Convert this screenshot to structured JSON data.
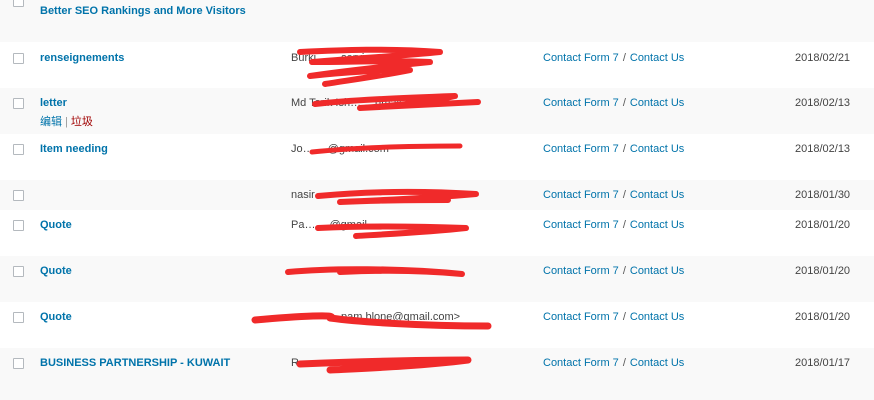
{
  "rows": [
    {
      "subject": "Better SEO Rankings and More Visitors",
      "from": "",
      "form_name": "",
      "form_page": "",
      "date": ""
    },
    {
      "subject": "renseignements",
      "from": "Burki… …services",
      "form_name": "Contact Form 7",
      "form_page": "Contact Us",
      "date": "2018/02/21"
    },
    {
      "subject": "letter",
      "from": "Md Tarik Ish… …gmail.com>",
      "form_name": "Contact Form 7",
      "form_page": "Contact Us",
      "date": "2018/02/13",
      "actions": {
        "edit": "编辑",
        "separator": "|",
        "trash": "垃圾"
      }
    },
    {
      "subject": "Item needing",
      "from": "Jo… …@gmail.com",
      "form_name": "Contact Form 7",
      "form_page": "Contact Us",
      "date": "2018/02/13"
    },
    {
      "subject": "",
      "from": "nasir",
      "form_name": "Contact Form 7",
      "form_page": "Contact Us",
      "date": "2018/01/30"
    },
    {
      "subject": "Quote",
      "from": "Pa… …@gmail",
      "form_name": "Contact Form 7",
      "form_page": "Contact Us",
      "date": "2018/01/20"
    },
    {
      "subject": "Quote",
      "from": "",
      "form_name": "Contact Form 7",
      "form_page": "Contact Us",
      "date": "2018/01/20"
    },
    {
      "subject": "Quote",
      "from": "…pam.blone@gmail.com>",
      "form_name": "Contact Form 7",
      "form_page": "Contact Us",
      "date": "2018/01/20"
    },
    {
      "subject": "BUSINESS PARTNERSHIP - KUWAIT",
      "from": "R… …m>",
      "form_name": "Contact Form 7",
      "form_page": "Contact Us",
      "date": "2018/01/17"
    }
  ],
  "colors": {
    "link": "#0073aa",
    "trash": "#a00000",
    "redaction": "#f02a2a",
    "alt_row": "#f9f9f9"
  }
}
